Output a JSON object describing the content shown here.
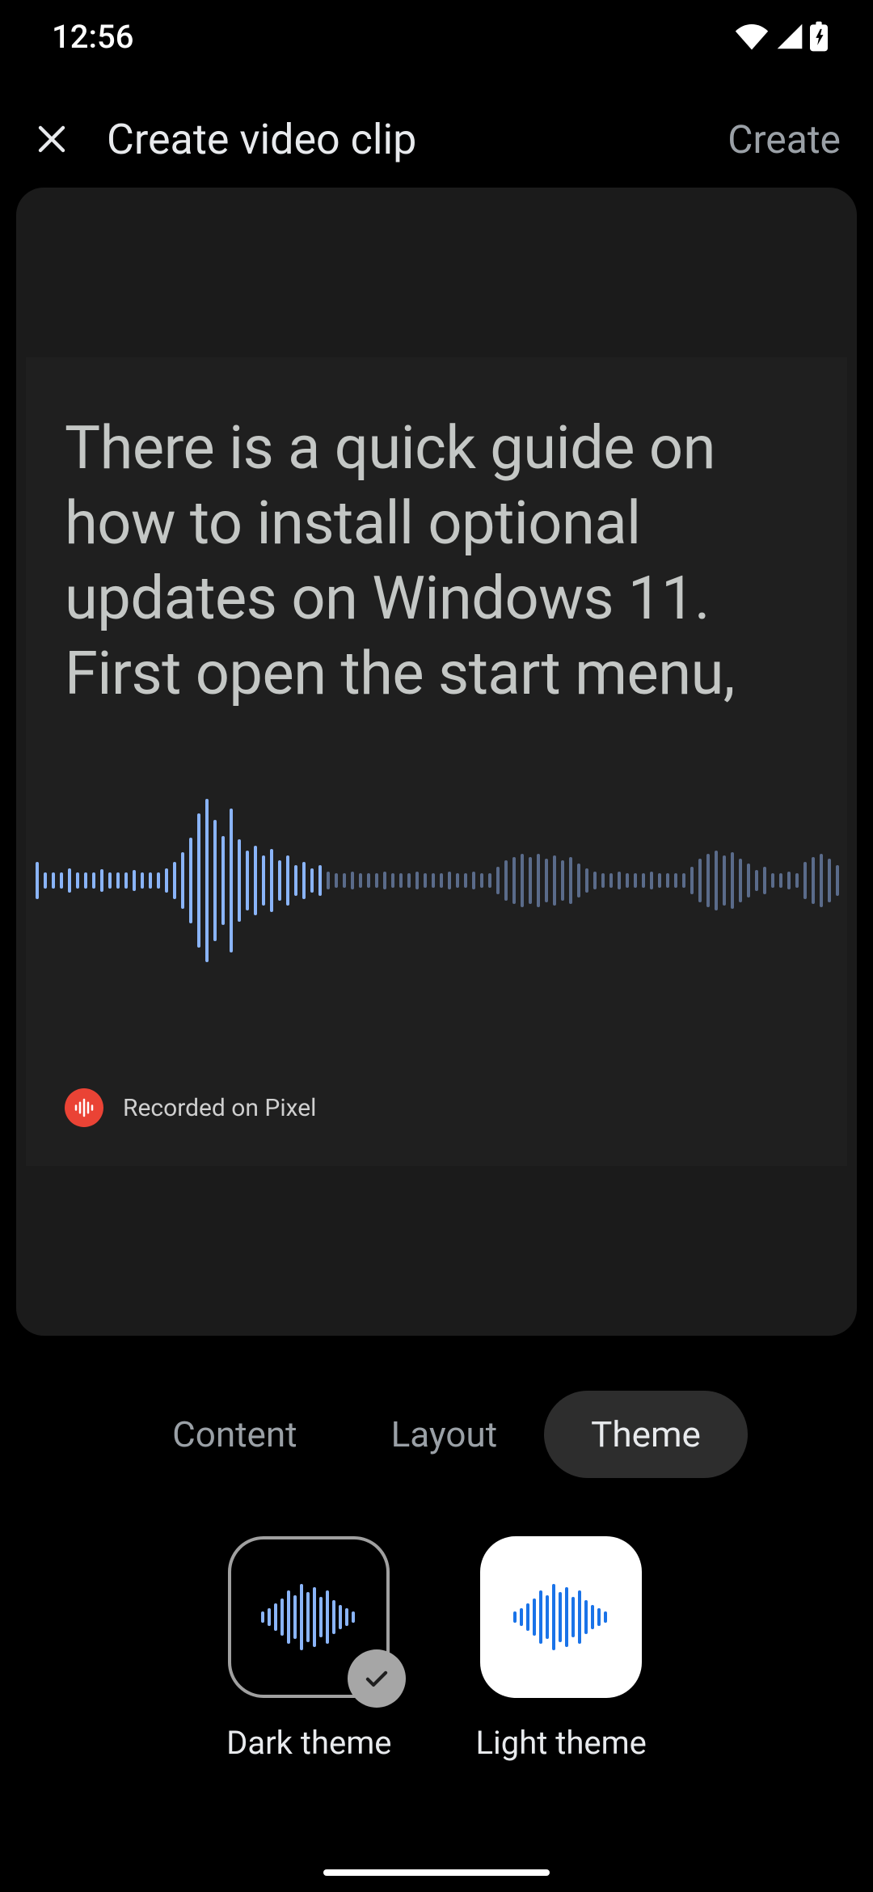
{
  "status": {
    "time": "12:56"
  },
  "appbar": {
    "title": "Create video clip",
    "create_label": "Create"
  },
  "preview": {
    "transcript": "There is a quick guide on how to install optional updates on Windows 11. First open the start menu,",
    "badge": "Recorded on Pixel"
  },
  "tabs": {
    "content": "Content",
    "layout": "Layout",
    "theme": "Theme"
  },
  "themes": {
    "dark": "Dark theme",
    "light": "Light theme"
  },
  "colors": {
    "accent": "#8ab4f8",
    "accent2": "#1a73e8",
    "danger": "#ea4335"
  }
}
